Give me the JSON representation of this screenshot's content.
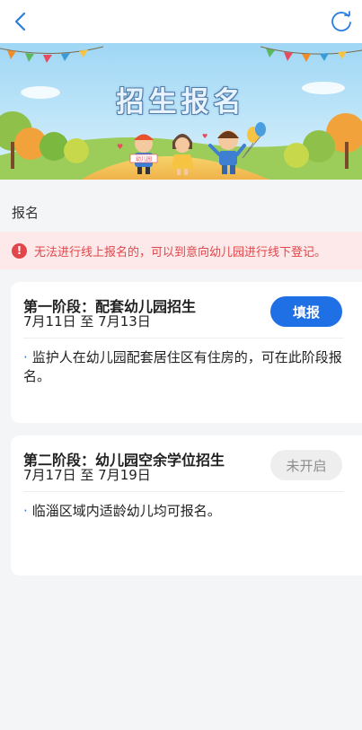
{
  "header": {
    "back_icon": "chevron-left-icon",
    "refresh_icon": "refresh-icon",
    "accent_color": "#1f6fe5"
  },
  "banner": {
    "title": "招生报名",
    "sign_text": "幼儿园"
  },
  "section": {
    "label": "报名"
  },
  "alert": {
    "icon": "exclamation-icon",
    "icon_glyph": "!",
    "text": "无法进行线上报名的，可以到意向幼儿园进行线下登记。",
    "color": "#e1464b"
  },
  "phases": [
    {
      "title": "第一阶段：配套幼儿园招生",
      "dates": "7月11日 至 7月13日",
      "description": "监护人在幼儿园配套居住区有住房的，可在此阶段报名。",
      "button_label": "填报",
      "status": "open"
    },
    {
      "title": "第二阶段：幼儿园空余学位招生",
      "dates": "7月17日 至 7月19日",
      "description": "临淄区域内适龄幼儿均可报名。",
      "button_label": "未开启",
      "status": "disabled"
    }
  ],
  "bullet": "·"
}
